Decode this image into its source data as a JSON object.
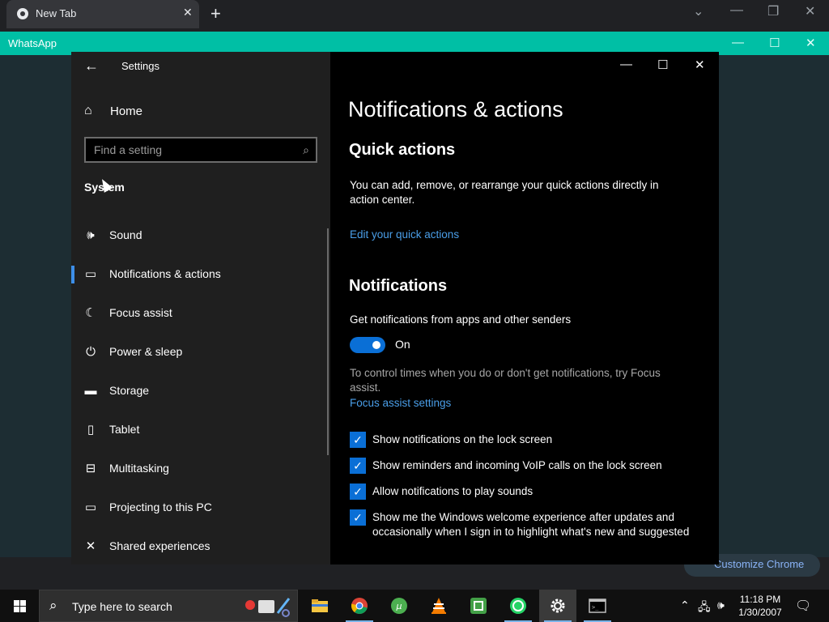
{
  "chrome": {
    "tab_title": "New Tab",
    "tab_close": "✕",
    "new_tab": "+",
    "controls": [
      "⌄",
      "—",
      "❐",
      "✕"
    ]
  },
  "whatsapp": {
    "title": "WhatsApp",
    "controls": [
      "—",
      "☐",
      "✕"
    ],
    "customize_label": "Customize Chrome"
  },
  "settings": {
    "window_title": "Settings",
    "back": "←",
    "home_label": "Home",
    "search_placeholder": "Find a setting",
    "section": "System",
    "nav_items": [
      {
        "label": "Sound",
        "icon": "speaker-icon"
      },
      {
        "label": "Notifications & actions",
        "icon": "message-icon",
        "selected": true
      },
      {
        "label": "Focus assist",
        "icon": "moon-icon"
      },
      {
        "label": "Power & sleep",
        "icon": "power-icon"
      },
      {
        "label": "Storage",
        "icon": "storage-icon"
      },
      {
        "label": "Tablet",
        "icon": "tablet-icon"
      },
      {
        "label": "Multitasking",
        "icon": "multitasking-icon"
      },
      {
        "label": "Projecting to this PC",
        "icon": "projector-icon"
      },
      {
        "label": "Shared experiences",
        "icon": "shared-icon"
      }
    ],
    "window_controls": [
      "—",
      "☐",
      "✕"
    ],
    "page_title": "Notifications & actions",
    "quick_actions": {
      "heading": "Quick actions",
      "desc": "You can add, remove, or rearrange your quick actions directly in action center.",
      "link": "Edit your quick actions"
    },
    "notifications": {
      "heading": "Notifications",
      "get_label": "Get notifications from apps and other senders",
      "toggle_state": "On",
      "focus_desc": "To control times when you do or don't get notifications, try Focus assist.",
      "focus_link": "Focus assist settings",
      "checkboxes": [
        {
          "label": "Show notifications on the lock screen",
          "checked": true
        },
        {
          "label": "Show reminders and incoming VoIP calls on the lock screen",
          "checked": true
        },
        {
          "label": "Allow notifications to play sounds",
          "checked": true
        },
        {
          "label": "Show me the Windows welcome experience after updates and occasionally when I sign in to highlight what's new and suggested",
          "checked": true
        }
      ]
    }
  },
  "taskbar": {
    "search_placeholder": "Type here to search",
    "apps": [
      {
        "name": "file-explorer",
        "color": "#f4c542"
      },
      {
        "name": "chrome",
        "color": "#34a853"
      },
      {
        "name": "utorrent",
        "color": "#4caf50"
      },
      {
        "name": "vlc",
        "color": "#f57c00"
      },
      {
        "name": "camtasia",
        "color": "#43a047"
      },
      {
        "name": "whatsapp",
        "color": "#25d366"
      },
      {
        "name": "settings",
        "color": "#ffffff"
      },
      {
        "name": "command-prompt",
        "color": "#c0c0c0"
      }
    ],
    "time": "11:18 PM",
    "date": "1/30/2007"
  }
}
